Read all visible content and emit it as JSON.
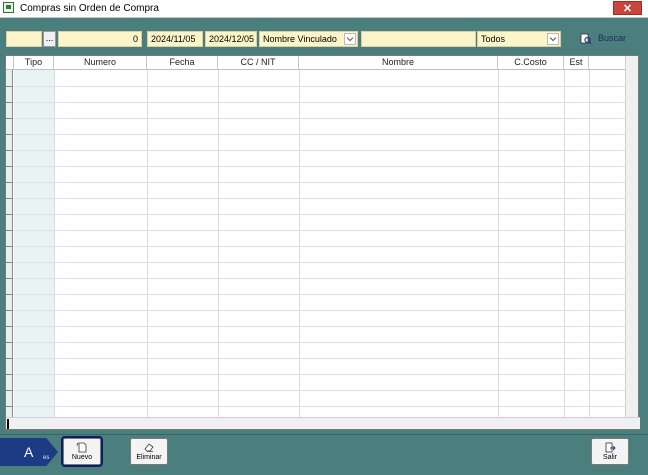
{
  "window": {
    "title": "Compras sin Orden de Compra",
    "close_label": "✕"
  },
  "filters": {
    "field1": "",
    "picker_label": "...",
    "number_value": "0",
    "date_from": "2024/11/05",
    "date_to": "2024/12/05",
    "linked_select": "Nombre Vinculado",
    "text_filter": "",
    "status_select": "Todos",
    "search_label": "Buscar"
  },
  "grid": {
    "columns": [
      "Tipo",
      "Numero",
      "Fecha",
      "CC / NIT",
      "Nombre",
      "C.Costo",
      "Est"
    ],
    "rows": []
  },
  "footer": {
    "agent_tag": "A",
    "agent_sub": "es",
    "new_label": "Nuevo",
    "delete_label": "Eliminar",
    "exit_label": "Salir"
  }
}
